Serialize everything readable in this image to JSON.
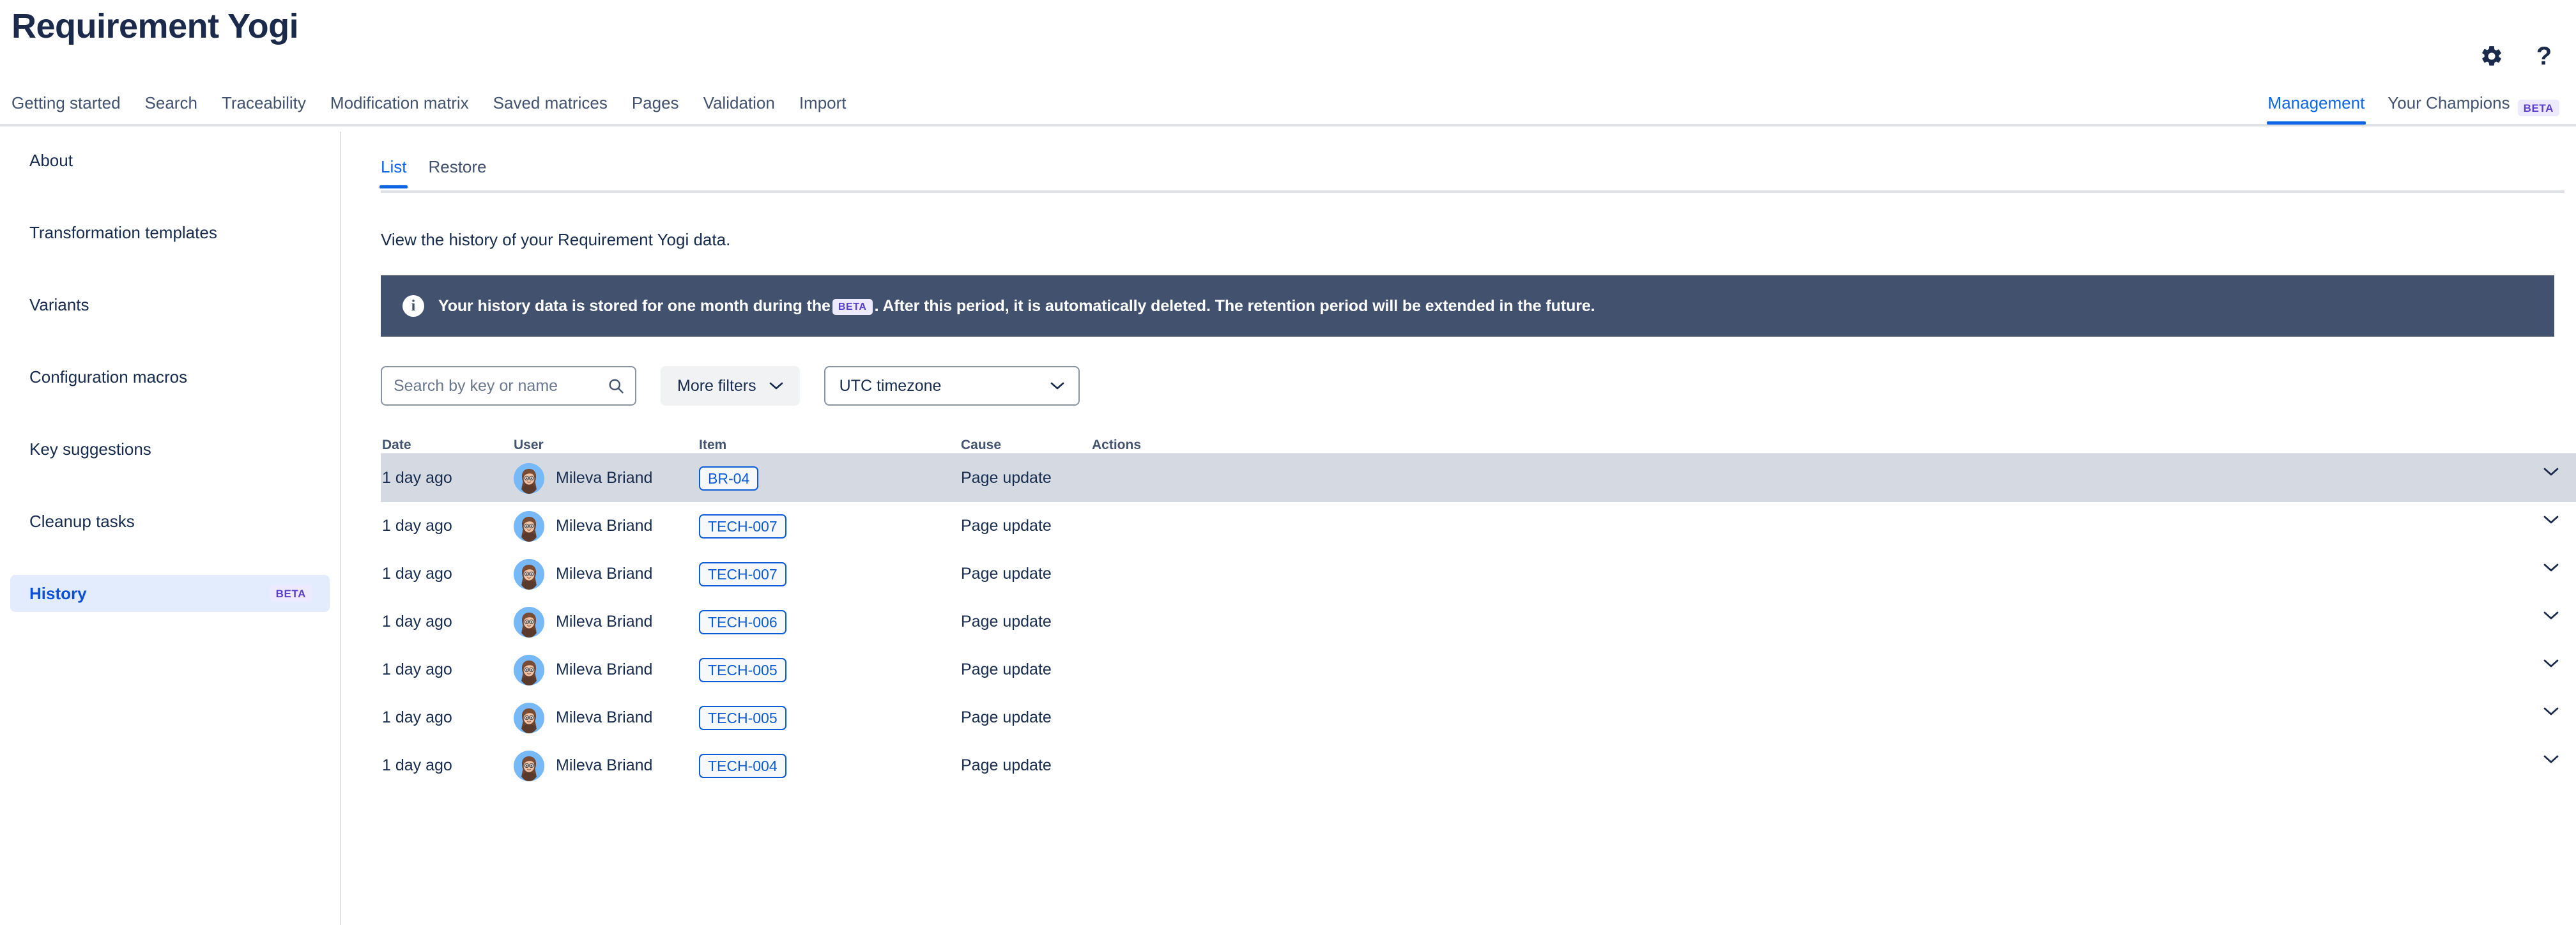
{
  "header": {
    "title": "Requirement Yogi",
    "icons": [
      {
        "name": "gear-icon",
        "label": "Settings"
      },
      {
        "name": "help-icon",
        "label": "?"
      }
    ]
  },
  "nav": {
    "left_items": [
      {
        "label": "Getting started"
      },
      {
        "label": "Search"
      },
      {
        "label": "Traceability"
      },
      {
        "label": "Modification matrix"
      },
      {
        "label": "Saved matrices"
      },
      {
        "label": "Pages"
      },
      {
        "label": "Validation"
      },
      {
        "label": "Import"
      }
    ],
    "right_items": [
      {
        "label": "Management",
        "active": true,
        "badge": ""
      },
      {
        "label": "Your Champions",
        "active": false,
        "badge": "BETA"
      }
    ]
  },
  "sidebar": {
    "items": [
      {
        "label": "About",
        "active": false,
        "badge": ""
      },
      {
        "label": "Transformation templates",
        "active": false,
        "badge": ""
      },
      {
        "label": "Variants",
        "active": false,
        "badge": ""
      },
      {
        "label": "Configuration macros",
        "active": false,
        "badge": ""
      },
      {
        "label": "Key suggestions",
        "active": false,
        "badge": ""
      },
      {
        "label": "Cleanup tasks",
        "active": false,
        "badge": ""
      },
      {
        "label": "History",
        "active": true,
        "badge": "BETA"
      }
    ]
  },
  "main": {
    "tabs": [
      {
        "label": "List",
        "active": true
      },
      {
        "label": "Restore",
        "active": false
      }
    ],
    "intro": "View the history of your Requirement Yogi data.",
    "banner": {
      "icon": "info-icon",
      "text_before": "Your history data is stored for one month during the",
      "badge": "BETA",
      "text_after": ". After this period, it is automatically deleted. The retention period will be extended in the future."
    },
    "filters": {
      "search_placeholder": "Search by key or name",
      "search_value": "",
      "more_filters_label": "More filters",
      "timezone_value": "UTC timezone"
    },
    "table": {
      "columns": [
        "Date",
        "User",
        "Item",
        "Cause",
        "Actions"
      ],
      "rows": [
        {
          "date": "1 day ago",
          "user": "Mileva Briand",
          "item": "BR-04",
          "cause": "Page update",
          "highlight": true
        },
        {
          "date": "1 day ago",
          "user": "Mileva Briand",
          "item": "TECH-007",
          "cause": "Page update",
          "highlight": false
        },
        {
          "date": "1 day ago",
          "user": "Mileva Briand",
          "item": "TECH-007",
          "cause": "Page update",
          "highlight": false
        },
        {
          "date": "1 day ago",
          "user": "Mileva Briand",
          "item": "TECH-006",
          "cause": "Page update",
          "highlight": false
        },
        {
          "date": "1 day ago",
          "user": "Mileva Briand",
          "item": "TECH-005",
          "cause": "Page update",
          "highlight": false
        },
        {
          "date": "1 day ago",
          "user": "Mileva Briand",
          "item": "TECH-005",
          "cause": "Page update",
          "highlight": false
        },
        {
          "date": "1 day ago",
          "user": "Mileva Briand",
          "item": "TECH-004",
          "cause": "Page update",
          "highlight": false
        }
      ]
    }
  },
  "colors": {
    "accent": "#0c66e4",
    "title": "#1b2a4a",
    "banner_bg": "#42526e",
    "badge_purple_bg": "#eeeafd",
    "badge_purple_fg": "#5a40cc",
    "sidebar_active_bg": "#e3ecfd",
    "row_highlight": "#d5d9e2",
    "item_badge": "#0b5cd5"
  }
}
